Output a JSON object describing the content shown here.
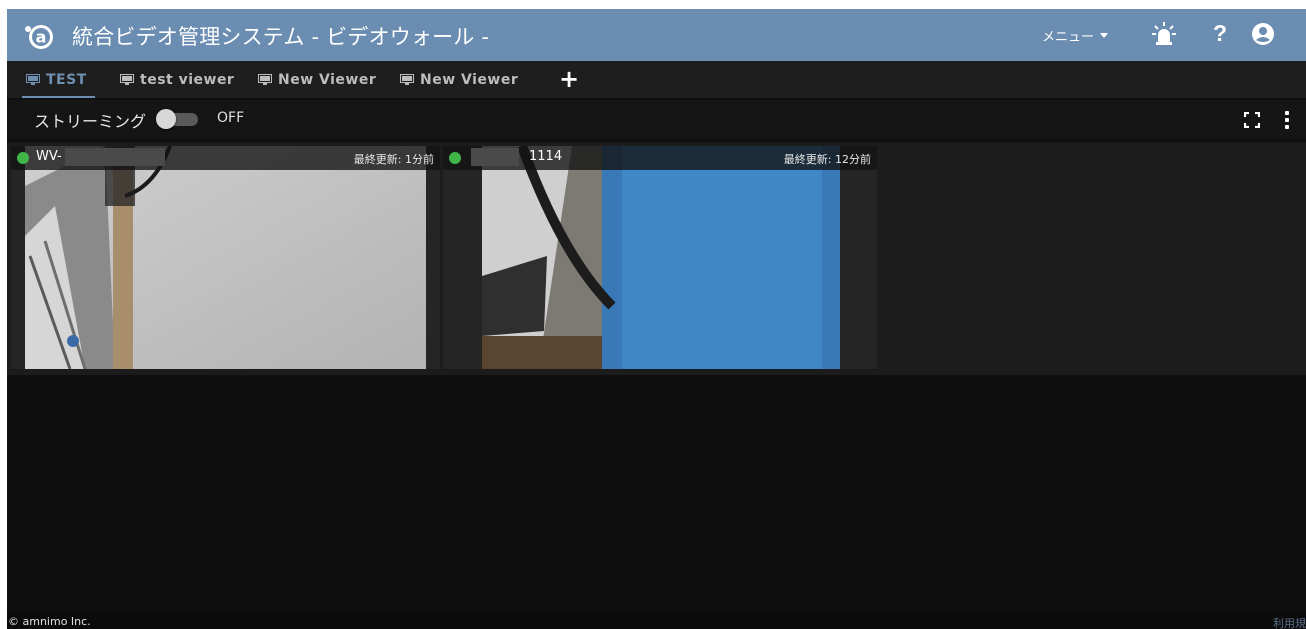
{
  "header": {
    "title": "統合ビデオ管理システム - ビデオウォール -",
    "menu_label": "メニュー",
    "help_label": "?",
    "logo_icon": "amnimo-logo-icon",
    "alarm_icon": "alarm-light-icon",
    "user_icon": "account-circle-icon",
    "accent_color": "#6a8db1"
  },
  "tabs": [
    {
      "label": "TEST",
      "icon": "monitor-icon",
      "active": true
    },
    {
      "label": "test viewer",
      "icon": "monitor-icon",
      "active": false
    },
    {
      "label": "New Viewer",
      "icon": "monitor-icon",
      "active": false
    },
    {
      "label": "New Viewer",
      "icon": "monitor-icon",
      "active": false
    }
  ],
  "add_tab_label": "+",
  "toolbar": {
    "streaming_label": "ストリーミング",
    "streaming_state": "OFF",
    "streaming_on": false,
    "fullscreen_icon": "fullscreen-icon",
    "more_icon": "more-vert-icon"
  },
  "cameras": [
    {
      "name": "WV-",
      "status": "online",
      "status_color": "#3fb54a",
      "last_update": "最終更新: 1分前"
    },
    {
      "name": "1114",
      "status": "online",
      "status_color": "#3fb54a",
      "last_update": "最終更新: 12分前"
    }
  ],
  "footer": {
    "copyright": "© amnimo Inc.",
    "terms": "利用規"
  }
}
